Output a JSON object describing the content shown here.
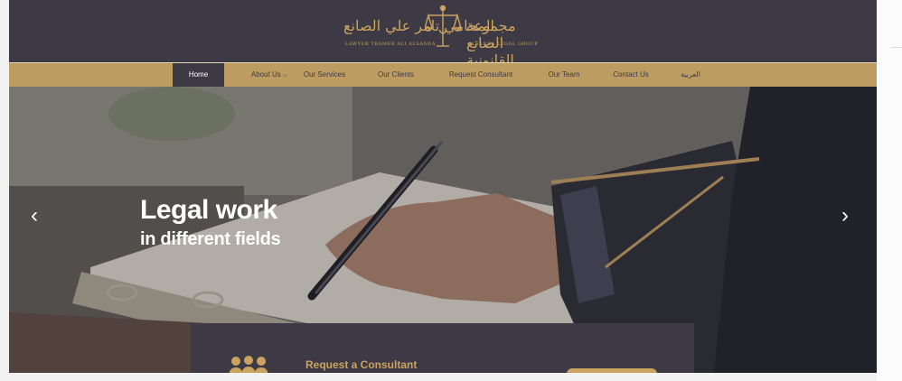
{
  "logo": {
    "arabic_left": "المحامي تامر علي الصانع",
    "latin_left": "LAWYER TRAMER ALI ALSANEA",
    "arabic_right": "مجموعة الصانع القانونية",
    "latin_right": "ALSANEA LEGAL GROUP"
  },
  "nav": {
    "items": [
      {
        "label": "Home",
        "active": true
      },
      {
        "label": "About Us",
        "has_dropdown": true
      },
      {
        "label": "Our Services"
      },
      {
        "label": "Our Clients"
      },
      {
        "label": "Request Consultant"
      },
      {
        "label": "Our Team"
      },
      {
        "label": "Contact Us"
      },
      {
        "label": "العربية"
      }
    ]
  },
  "hero": {
    "title": "Legal work",
    "subtitle": "in different fields",
    "prev_arrow": "‹",
    "next_arrow": "›"
  },
  "consult": {
    "label": "Request a Consultant"
  },
  "icons": [
    "scales-of-justice-icon",
    "chevron-left-icon",
    "chevron-right-icon",
    "chevron-down-icon",
    "people-group-icon"
  ],
  "colors": {
    "dark": "#3d3a45",
    "gold": "#bc9c61",
    "accent_gold": "#c9a35f",
    "white": "#ffffff"
  }
}
